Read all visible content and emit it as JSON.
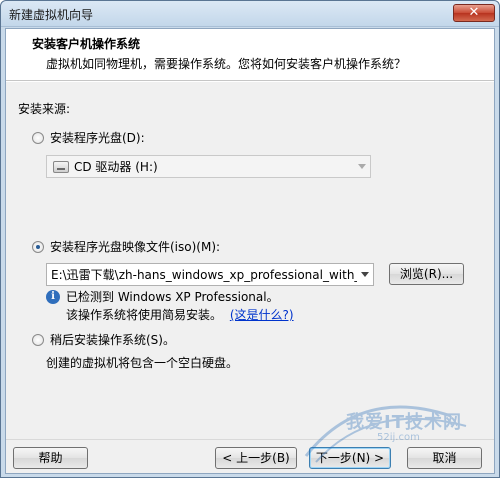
{
  "window": {
    "title": "新建虚拟机向导",
    "close_glyph": "✕"
  },
  "header": {
    "title": "安装客户机操作系统",
    "subtitle": "虚拟机如同物理机，需要操作系统。您将如何安装客户机操作系统？"
  },
  "install_source": {
    "label": "安装来源:",
    "disc_option": {
      "label": "安装程序光盘(D):",
      "selected": false
    },
    "disc_combo_value": "CD 驱动器 (H:)",
    "iso_option": {
      "label": "安装程序光盘映像文件(iso)(M):",
      "selected": true
    },
    "iso_path": "E:\\迅雷下载\\zh-hans_windows_xp_professional_with_ser",
    "browse_label": "浏览(R)...",
    "detected_text": "已检测到 Windows XP Professional。",
    "easy_install_text": "该操作系统将使用简易安装。",
    "whats_this_link": "(这是什么?)",
    "later_option": {
      "label": "稍后安装操作系统(S)。",
      "selected": false
    },
    "later_desc": "创建的虚拟机将包含一个空白硬盘。"
  },
  "footer": {
    "help_label": "帮助",
    "back_label": "< 上一步(B)",
    "next_label": "下一步(N) >",
    "cancel_label": "取消"
  },
  "watermark": {
    "text": "我爱IT技术网",
    "sub": "52ij.com"
  },
  "colors": {
    "accent": "#2a5d96",
    "link": "#0033cc",
    "close": "#c94a34"
  }
}
